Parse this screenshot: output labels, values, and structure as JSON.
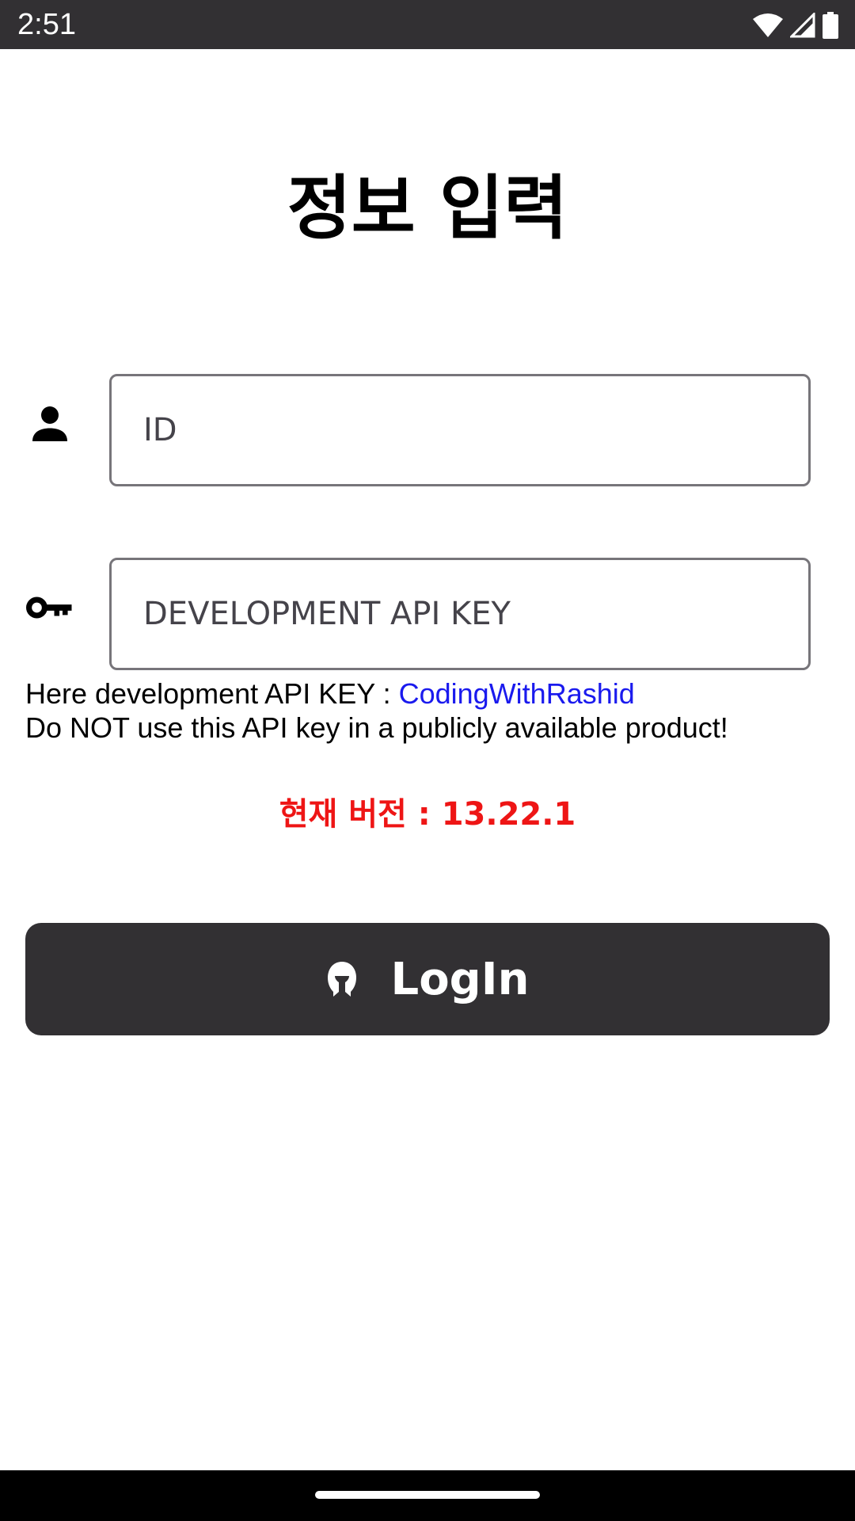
{
  "status_bar": {
    "time": "2:51",
    "icons": [
      "wifi-icon",
      "cell-signal-icon",
      "battery-icon"
    ]
  },
  "page": {
    "title": "정보 입력"
  },
  "form": {
    "id_field": {
      "placeholder": "ID",
      "value": "",
      "icon": "person-icon"
    },
    "api_key_field": {
      "placeholder": "DEVELOPMENT API KEY",
      "value": "",
      "icon": "key-icon"
    }
  },
  "helper": {
    "line1_prefix": "Here development API KEY : ",
    "api_key_link": "CodingWithRashid",
    "line2": "Do NOT use this API key in a publicly available product!"
  },
  "version": {
    "text": "현재 버전 : 13.22.1"
  },
  "login_button": {
    "label": "LogIn",
    "icon": "helmet-icon"
  },
  "colors": {
    "status_bar_bg": "#323033",
    "button_bg": "#323033",
    "link": "#1a1aee",
    "version_text": "#ee1515",
    "field_border": "#77757a"
  }
}
